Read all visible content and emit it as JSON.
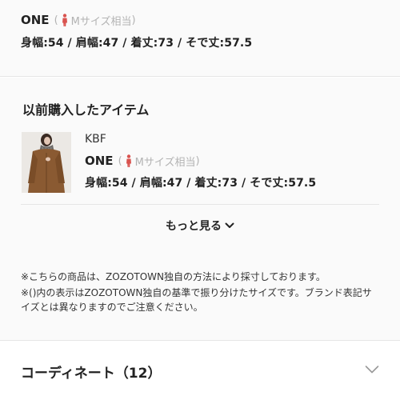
{
  "current_size": {
    "label": "ONE",
    "fit_note_open": "(",
    "fit_note_text": "Mサイズ相当",
    "fit_note_close": ")",
    "measurements": "身幅:54 / 肩幅:47 / 着丈:73 / そで丈:57.5"
  },
  "history": {
    "title": "以前購入したアイテム",
    "items": [
      {
        "brand": "KBF",
        "size_label": "ONE",
        "fit_note_open": "(",
        "fit_note_text": "Mサイズ相当",
        "fit_note_close": ")",
        "measurements": "身幅:54 / 肩幅:47 / 着丈:73 / そで丈:57.5"
      }
    ],
    "more_label": "もっと見る"
  },
  "notes": [
    "※こちらの商品は、ZOZOTOWN独自の方法により採寸しております。",
    "※()内の表示はZOZOTOWN独自の基準で振り分けたサイズです。ブランド表記サイズとは異なりますのでご注意ください。"
  ],
  "coordinate": {
    "label": "コーディネート（12）"
  },
  "icons": {
    "fit_person": "person-figure-icon",
    "more_chevron": "chevron-down-icon",
    "coordinate_chevron": "chevron-down-icon"
  },
  "colors": {
    "person_icon": "#d9534f",
    "muted_text": "#b3b3b3",
    "section_bg": "#fafafa"
  }
}
